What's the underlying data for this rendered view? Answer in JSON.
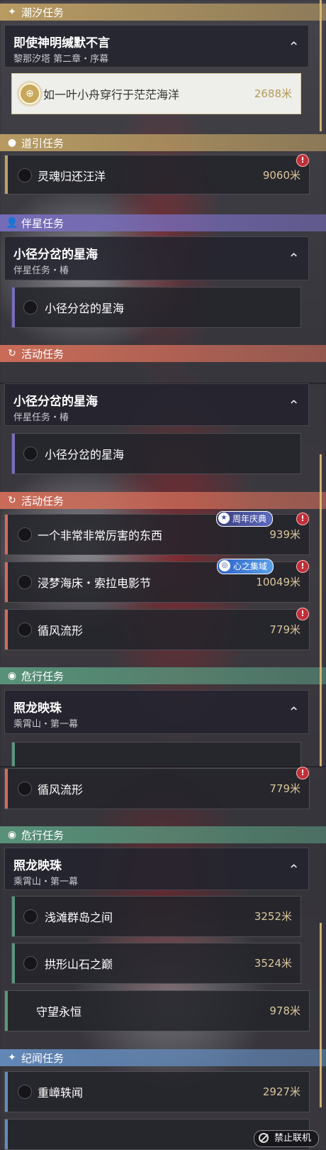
{
  "categories": {
    "chaoxi": "潮汐任务",
    "daoyin": "道引任务",
    "banxing": "伴星任务",
    "huodong": "活动任务",
    "weixing": "危行任务",
    "jiwen": "纪闻任务"
  },
  "groups": {
    "shenming": {
      "title": "即使神明缄默不言",
      "subtitle": "黎那汐塔 第二章・序幕"
    },
    "xiaojing": {
      "title": "小径分岔的星海",
      "subtitle": "伴星任务・椿"
    },
    "zhaolong": {
      "title": "照龙映珠",
      "subtitle": "乘霄山・第一幕"
    }
  },
  "items": {
    "yiye": {
      "name": "如一叶小舟穿行于茫茫海洋",
      "distance": "2688米"
    },
    "linghun": {
      "name": "灵魂归还汪洋",
      "distance": "9060米"
    },
    "xiaojing": {
      "name": "小径分岔的星海"
    },
    "yige": {
      "name": "一个非常非常厉害的东西",
      "distance": "939米"
    },
    "jinmeng": {
      "name": "浸梦海床・索拉电影节",
      "distance": "10049米"
    },
    "xunfeng": {
      "name": "循风流形",
      "distance": "779米"
    },
    "qiantan": {
      "name": "浅滩群岛之间",
      "distance": "3252米"
    },
    "gongxing": {
      "name": "拱形山石之巅",
      "distance": "3524米"
    },
    "shouwang": {
      "name": "守望永恒",
      "distance": "978米"
    },
    "chongzhang": {
      "name": "重嶂轶闻",
      "distance": "2927米"
    }
  },
  "badges": {
    "anniversary": "周年庆典",
    "heart": "心之集域"
  },
  "footer": {
    "button": "禁止联机"
  },
  "colors": {
    "chaoxi": "#bea064",
    "banxing": "#786ebe",
    "huodong": "#d26e5a",
    "weixing": "#5a967d",
    "jiwen": "#648cbe",
    "warn": "#c0303a"
  }
}
